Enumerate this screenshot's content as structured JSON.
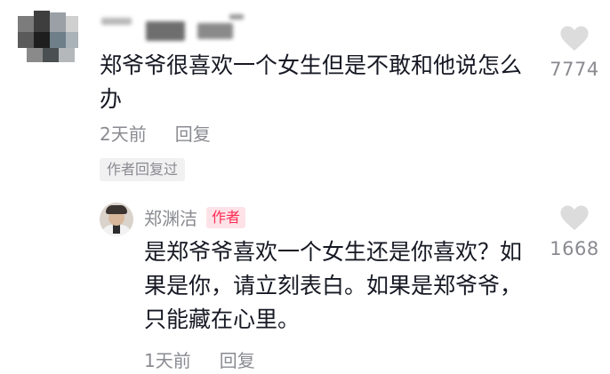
{
  "comment": {
    "text": "郑爷爷很喜欢一个女生但是不敢和他说怎么办",
    "time": "2天前",
    "reply_label": "回复",
    "author_replied_tag": "作者回复过",
    "like_count": "7774",
    "like_icon": "heart-icon"
  },
  "reply": {
    "author_name": "郑渊洁",
    "author_badge": "作者",
    "text": "是郑爷爷喜欢一个女生还是你喜欢？如果是你，请立刻表白。如果是郑爷爷，只能藏在心里。",
    "time": "1天前",
    "reply_label": "回复",
    "like_count": "1668",
    "like_icon": "heart-icon"
  },
  "colors": {
    "text_primary": "#161823",
    "text_secondary": "#8a8b91",
    "heart": "#dcdcdc",
    "badge_bg": "#fde3e8",
    "badge_text": "#fe2c55"
  }
}
